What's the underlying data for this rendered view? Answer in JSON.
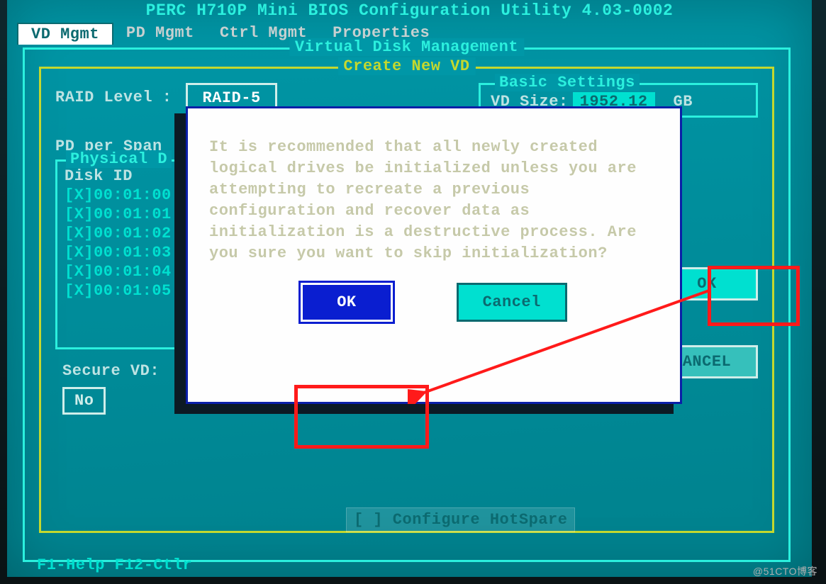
{
  "title": "PERC H710P Mini BIOS Configuration Utility 4.03-0002",
  "tabs": {
    "vd": "VD Mgmt",
    "pd": "PD Mgmt",
    "ctrl": "Ctrl Mgmt",
    "prop": "Properties"
  },
  "panel_label": "Virtual Disk Management",
  "create_label": "Create New VD",
  "raid": {
    "label": "RAID Level :",
    "value": "RAID-5"
  },
  "basic": {
    "label": "Basic Settings",
    "vd_size_label": "VD Size:",
    "vd_size_value": "1952.12",
    "vd_size_unit": "GB"
  },
  "pd_span_label": "PD per Span :",
  "phys_label": "Physical D",
  "disk_header": "Disk ID",
  "disks": [
    "[X]00:01:00",
    "[X]00:01:01",
    "[X]00:01:02",
    "[X]00:01:03",
    "[X]00:01:04",
    "[X]00:01:05"
  ],
  "secure": {
    "label": "Secure VD:",
    "value": "No"
  },
  "right_ok": "OK",
  "right_cancel": "ANCEL",
  "hotspare": "[ ] Configure HotSpare",
  "modal": {
    "text": "It is recommended that all newly created logical drives be initialized unless you are attempting to recreate a previous configuration and recover data as initialization is a destructive process. Are you sure you want to skip initialization?",
    "ok": "OK",
    "cancel": "Cancel"
  },
  "help": "F1-Help F12-Ctlr",
  "watermark": "@51CTO博客"
}
